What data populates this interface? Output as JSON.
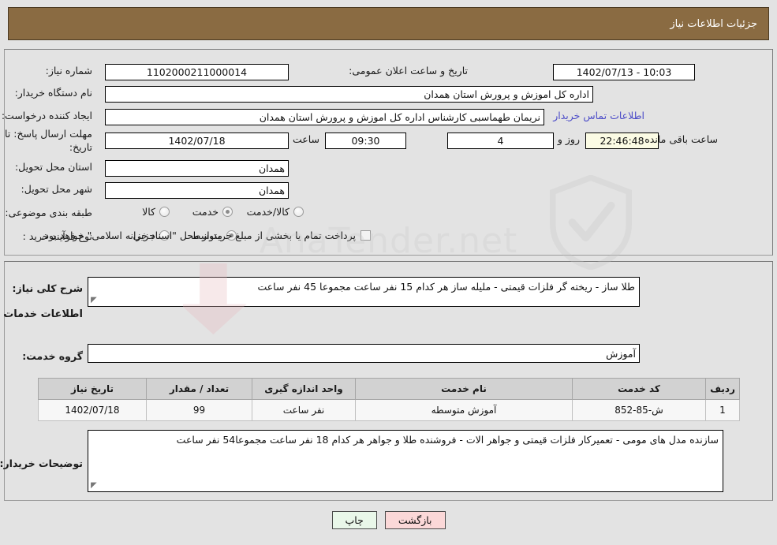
{
  "header": {
    "title": "جزئیات اطلاعات نیاز"
  },
  "top": {
    "need_number_label": "شماره نیاز:",
    "need_number_value": "1102000211000014",
    "announce_label": "تاریخ و ساعت اعلان عمومی:",
    "announce_value": "10:03 - 1402/07/13",
    "buyer_org_label": "نام دستگاه خریدار:",
    "buyer_org_value": "اداره کل اموزش و پرورش استان همدان",
    "creator_label": "ایجاد کننده درخواست:",
    "creator_value": "نریمان طهماسبی کارشناس اداره کل اموزش و پرورش استان همدان",
    "contact_link": "اطلاعات تماس خریدار",
    "deadline_label": "مهلت ارسال پاسخ: تا تاریخ:",
    "deadline_date": "1402/07/18",
    "time_label": "ساعت",
    "deadline_time": "09:30",
    "days_value": "4",
    "days_label": "روز و",
    "countdown_value": "22:46:48",
    "countdown_label": "ساعت باقی مانده",
    "province_label": "استان محل تحویل:",
    "province_value": "همدان",
    "city_label": "شهر محل تحویل:",
    "city_value": "همدان",
    "category_label": "طبقه بندی موضوعی:",
    "category_options": [
      {
        "label": "کالا",
        "checked": false
      },
      {
        "label": "خدمت",
        "checked": true
      },
      {
        "label": "کالا/خدمت",
        "checked": false
      }
    ],
    "process_label": "نوع فرآیند خرید :",
    "process_options": [
      {
        "label": "جزیی",
        "checked": false
      },
      {
        "label": "متوسط",
        "checked": true
      }
    ],
    "treasury_checkbox_label": "پرداخت تمام یا بخشی از مبلغ خرید،از محل \"اسناد خزانه اسلامی\" خواهد بود.",
    "treasury_checked": false
  },
  "bottom": {
    "general_desc_label": "شرح کلی نیاز:",
    "general_desc_value": "طلا ساز - ریخته گر فلزات قیمتی - ملیله ساز هر کدام 15 نفر ساعت مجموعا 45 نفر ساعت",
    "services_heading": "اطلاعات خدمات مورد نیاز",
    "service_group_label": "گروه خدمت:",
    "service_group_value": "آموزش",
    "table": {
      "headers": [
        "ردیف",
        "کد خدمت",
        "نام خدمت",
        "واحد اندازه گیری",
        "تعداد / مقدار",
        "تاریخ نیاز"
      ],
      "rows": [
        [
          "1",
          "ش-85-852",
          "آموزش متوسطه",
          "نفر ساعت",
          "99",
          "1402/07/18"
        ]
      ]
    },
    "buyer_notes_label": "توضیحات خریدار:",
    "buyer_notes_value": "سازنده مدل های مومی - تعمیرکار فلزات قیمتی و جواهر الات - فروشنده طلا و جواهر هر کدام 18 نفر ساعت مجموعا54 نفر ساعت"
  },
  "footer": {
    "print_label": "چاپ",
    "back_label": "بازگشت"
  },
  "watermark": {
    "text": "AnaTender.net"
  },
  "colors": {
    "header_bg": "#8a6b42",
    "page_bg": "#e3e3e3",
    "link": "#4c4cc8",
    "highlight_yellow": "#fbfbe4",
    "print_btn": "#e9f7e9",
    "back_btn": "#fbd8d8"
  }
}
